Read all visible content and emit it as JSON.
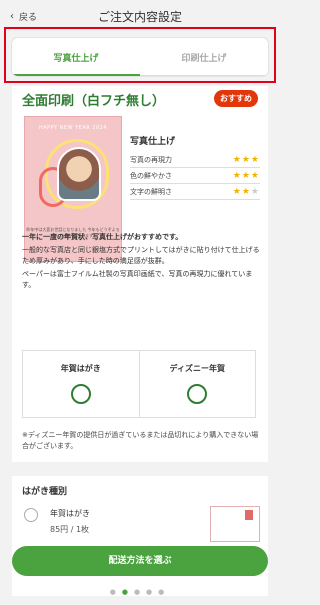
{
  "header": {
    "back_label": "戻る",
    "title": "ご注文内容設定"
  },
  "tabs": [
    {
      "label": "写真仕上げ",
      "active": true
    },
    {
      "label": "印刷仕上げ",
      "active": false
    }
  ],
  "main": {
    "title": "全面印刷（白フチ無し）",
    "badge": "おすすめ",
    "card_heading": "HAPPY NEW YEAR 2024",
    "card_caption": "昨年中は大変お世話になりました\n今年もどうぞよろしくお願いいたします",
    "spec_title": "写真仕上げ",
    "specs": [
      {
        "label": "写真の再現力",
        "stars": 3
      },
      {
        "label": "色の鮮やかさ",
        "stars": 3
      },
      {
        "label": "文字の鮮明さ",
        "stars": 2
      }
    ],
    "desc_strong": "一年に一度の年賀状、写真仕上げがおすすめです。",
    "desc_text": "一般的な写真店と同じ銀塩方式でプリントしてはがきに貼り付けて仕上げるため厚みがあり、手にした時の満足感が抜群。",
    "desc_text2": "ペーパーは富士フイルム社製の写真印画紙で、写真の再現力に優れています。",
    "choices": [
      {
        "label": "年賀はがき",
        "mark": "○"
      },
      {
        "label": "ディズニー年賀",
        "mark": "○"
      }
    ],
    "note": "※ディズニー年賀の提供日が過ぎているまたは品切れにより購入できない場合がございます。"
  },
  "postcard_section": {
    "title": "はがき種別",
    "option_label": "年賀はがき",
    "option_sub": "85円 / 1枚"
  },
  "cta": {
    "label": "配送方法を選ぶ"
  },
  "pager": {
    "count": 5,
    "active_index": 1
  },
  "colors": {
    "accent": "#4aa33e",
    "title_green": "#2f7d32",
    "badge": "#e3360a",
    "highlight_box": "#e3001b",
    "star": "#f0b400"
  }
}
